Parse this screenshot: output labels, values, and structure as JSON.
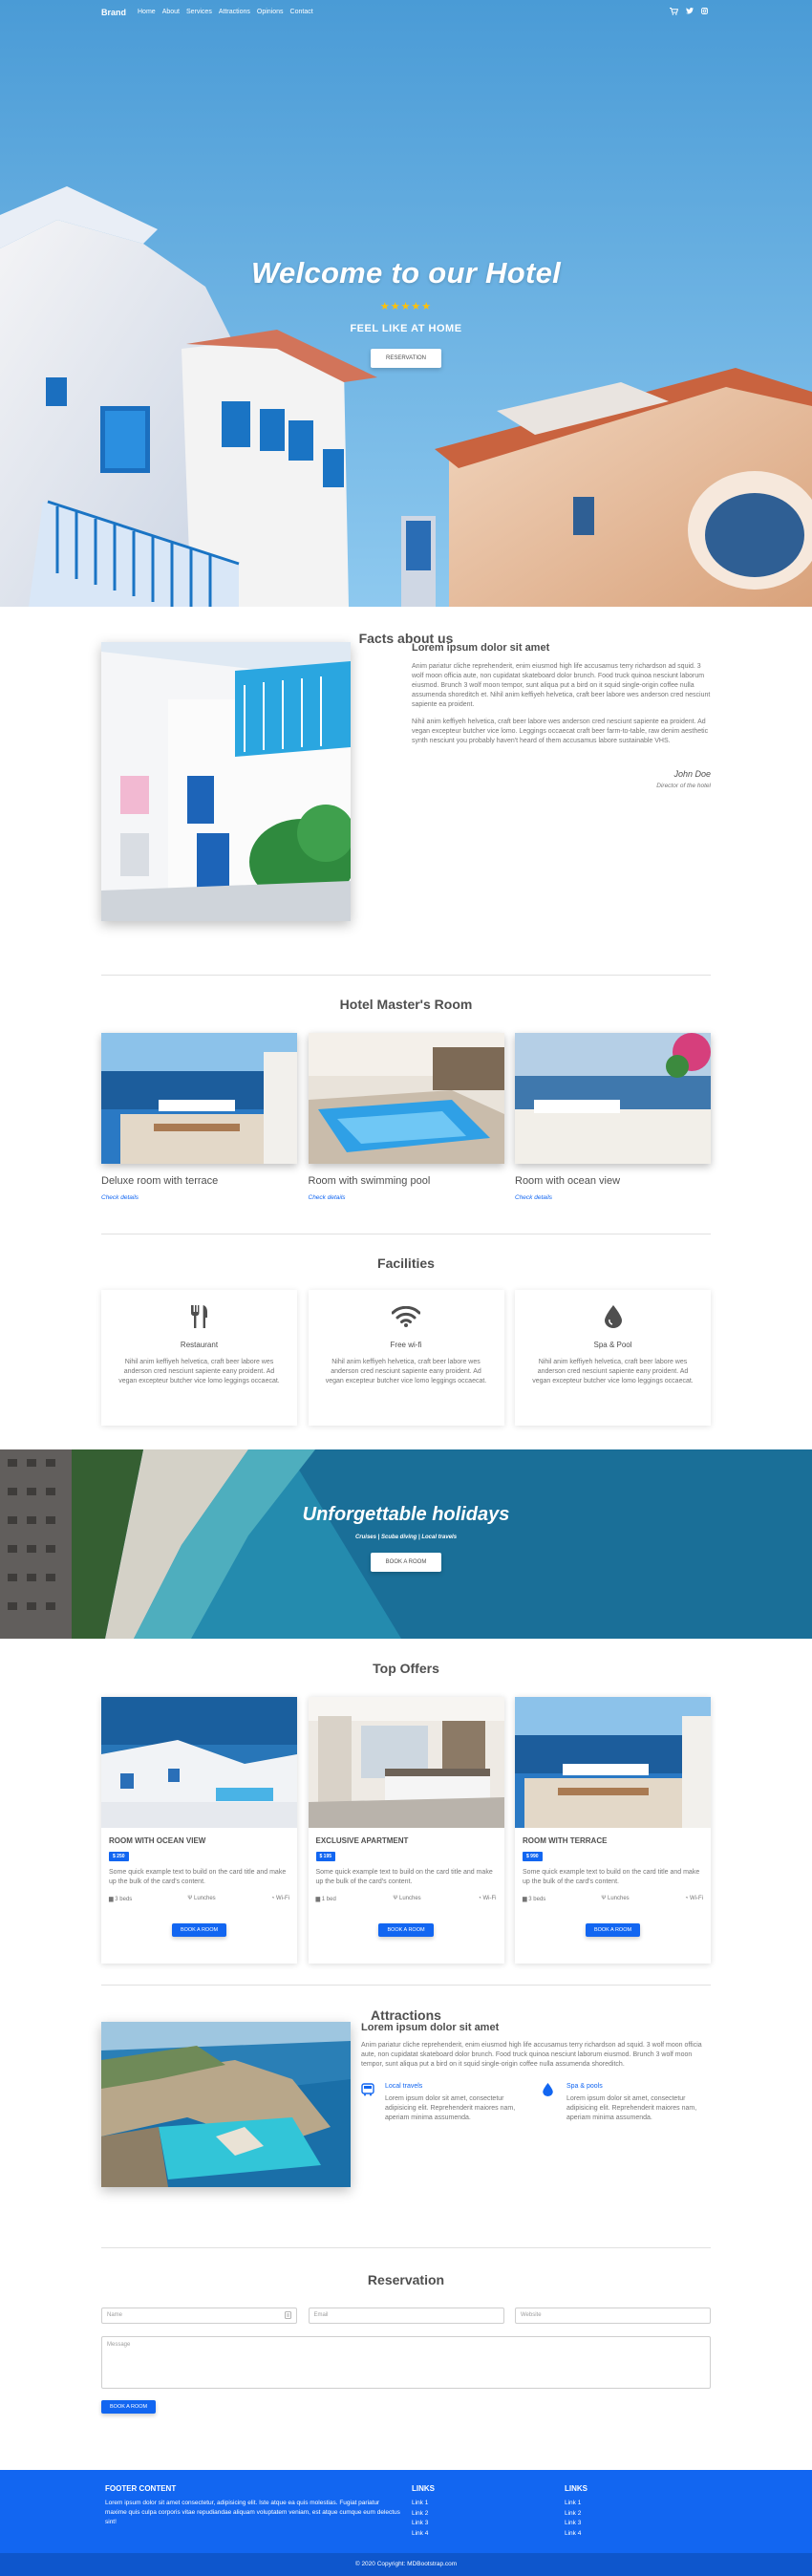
{
  "navbar": {
    "brand": "Brand",
    "links": [
      "Home",
      "About",
      "Services",
      "Attractions",
      "Opinions",
      "Contact"
    ],
    "icons": [
      "cart-icon",
      "twitter-icon",
      "instagram-icon"
    ]
  },
  "hero": {
    "title": "Welcome to our Hotel",
    "stars": "★★★★★",
    "subtitle": "FEEL LIKE AT HOME",
    "button": "RESERVATION"
  },
  "facts": {
    "title": "Facts about us",
    "heading": "Lorem ipsum dolor sit amet",
    "p1": "Anim pariatur cliche reprehenderit, enim eiusmod high life accusamus terry richardson ad squid. 3 wolf moon officia aute, non cupidatat skateboard dolor brunch. Food truck quinoa nesciunt laborum eiusmod. Brunch 3 wolf moon tempor, sunt aliqua put a bird on it squid single-origin coffee nulla assumenda shoreditch et. Nihil anim keffiyeh helvetica, craft beer labore wes anderson cred nesciunt sapiente ea proident.",
    "p2": "Nihil anim keffiyeh helvetica, craft beer labore wes anderson cred nesciunt sapiente ea proident. Ad vegan excepteur butcher vice lomo. Leggings occaecat craft beer farm-to-table, raw denim aesthetic synth nesciunt you probably haven't heard of them accusamus labore sustainable VHS.",
    "signature_name": "John Doe",
    "signature_role": "Director of the hotel"
  },
  "rooms": {
    "title": "Hotel Master's Room",
    "items": [
      {
        "title": "Deluxe room with terrace",
        "link": "Check details"
      },
      {
        "title": "Room with swimming pool",
        "link": "Check details"
      },
      {
        "title": "Room with ocean view",
        "link": "Check details"
      }
    ]
  },
  "facilities": {
    "title": "Facilities",
    "items": [
      {
        "icon": "utensils-icon",
        "title": "Restaurant",
        "text": "Nihil anim keffiyeh helvetica, craft beer labore wes anderson cred nesciunt sapiente eanу proident. Ad vegan excepteur butcher vice lomo leggings occaecat."
      },
      {
        "icon": "wifi-icon",
        "title": "Free wi-fi",
        "text": "Nihil anim keffiyeh helvetica, craft beer labore wes anderson cred nesciunt sapiente eanу proident. Ad vegan excepteur butcher vice lomo leggings occaecat."
      },
      {
        "icon": "tint-icon",
        "title": "Spa & Pool",
        "text": "Nihil anim keffiyeh helvetica, craft beer labore wes anderson cred nesciunt sapiente eanу proident. Ad vegan excepteur butcher vice lomo leggings occaecat."
      }
    ]
  },
  "holiday": {
    "title": "Unforgettable holidays",
    "subtitle": "Cruises | Scuba diving | Local travels",
    "button": "BOOK A ROOM"
  },
  "offers": {
    "title": "Top Offers",
    "items": [
      {
        "title": "ROOM WITH OCEAN VIEW",
        "price": "$ 250",
        "text": "Some quick example text to build on the card title and make up the bulk of the card's content.",
        "beds": "3 beds",
        "food": "Lunches",
        "wifi": "Wi-Fi",
        "button": "BOOK A ROOM"
      },
      {
        "title": "EXCLUSIVE APARTMENT",
        "price": "$ 195",
        "text": "Some quick example text to build on the card title and make up the bulk of the card's content.",
        "beds": "1 bed",
        "food": "Lunches",
        "wifi": "Wi-Fi",
        "button": "BOOK A ROOM"
      },
      {
        "title": "ROOM WITH TERRACE",
        "price": "$ 990",
        "text": "Some quick example text to build on the card title and make up the bulk of the card's content.",
        "beds": "3 beds",
        "food": "Lunches",
        "wifi": "Wi-Fi",
        "button": "BOOK A ROOM"
      }
    ]
  },
  "attractions": {
    "title": "Attractions",
    "heading": "Lorem ipsum dolor sit amet",
    "text": "Anim pariatur cliche reprehenderit, enim eiusmod high life accusamus terry richardson ad squid. 3 wolf moon officia aute, non cupidatat skateboard dolor brunch. Food truck quinoa nesciunt laborum eiusmod. Brunch 3 wolf moon tempor, sunt aliqua put a bird on it squid single-origin coffee nulla assumenda shoreditch.",
    "features": [
      {
        "icon": "bus-icon",
        "title": "Local travels",
        "text": "Lorem ipsum dolor sit amet, consectetur adipisicing elit. Reprehenderit maiores nam, aperiam minima assumenda."
      },
      {
        "icon": "tint-icon",
        "title": "Spa & pools",
        "text": "Lorem ipsum dolor sit amet, consectetur adipisicing elit. Reprehenderit maiores nam, aperiam minima assumenda."
      }
    ]
  },
  "reservation": {
    "title": "Reservation",
    "name_placeholder": "Name",
    "email_placeholder": "Email",
    "website_placeholder": "Website",
    "message_placeholder": "Message",
    "button": "BOOK A ROOM"
  },
  "footer": {
    "content_title": "FOOTER CONTENT",
    "content_text": "Lorem ipsum dolor sit amet consectetur, adipisicing elit. Iste atque ea quis molestias. Fugiat pariatur maxime quis culpa corporis vitae repudiandae aliquam voluptatem veniam, est atque cumque eum delectus sint!",
    "links_title_1": "LINKS",
    "links_1": [
      "Link 1",
      "Link 2",
      "Link 3",
      "Link 4"
    ],
    "links_title_2": "LINKS",
    "links_2": [
      "Link 1",
      "Link 2",
      "Link 3",
      "Link 4"
    ],
    "copyright": "© 2020 Copyright: MDBootstrap.com"
  },
  "colors": {
    "primary": "#1266f1",
    "stars": "#ffc107",
    "text": "#4f4f4f"
  }
}
